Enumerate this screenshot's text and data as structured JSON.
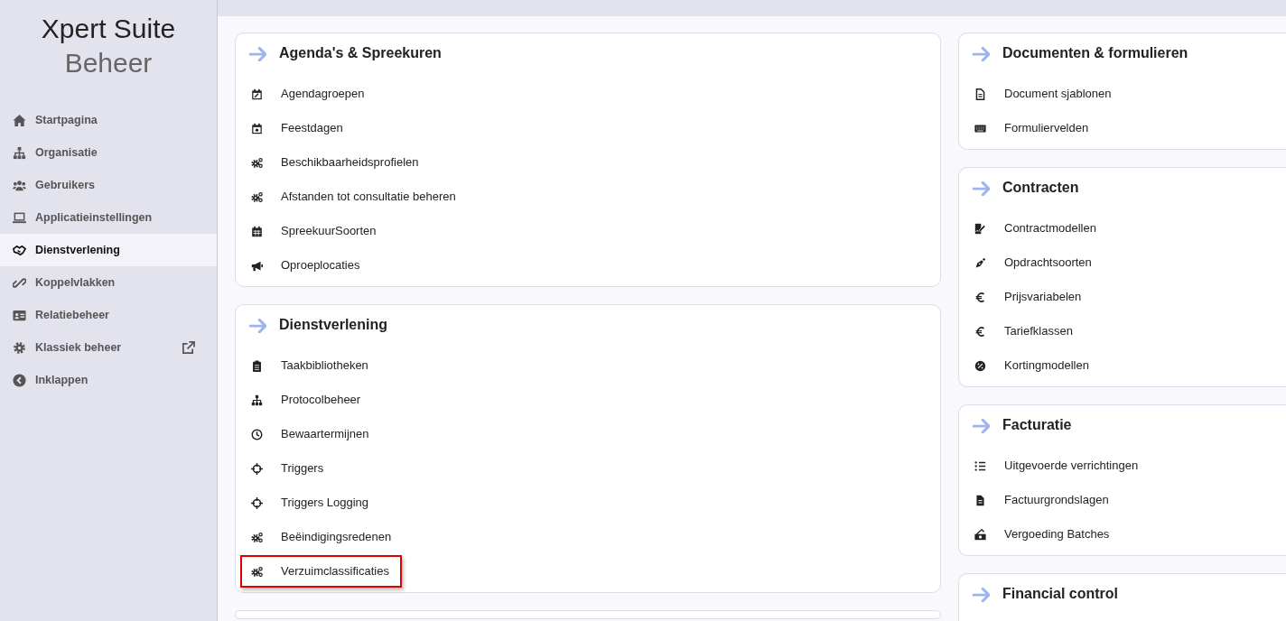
{
  "logo": {
    "line_1": "Xpert Suite",
    "line_2": "Beheer"
  },
  "sidebar": {
    "items": [
      {
        "label": "Startpagina",
        "kind": "home",
        "selected": false,
        "external": false
      },
      {
        "label": "Organisatie",
        "kind": "sitemap",
        "selected": false,
        "external": false
      },
      {
        "label": "Gebruikers",
        "kind": "users",
        "selected": false,
        "external": false
      },
      {
        "label": "Applicatieinstellingen",
        "kind": "laptop",
        "selected": false,
        "external": false
      },
      {
        "label": "Dienstverlening",
        "kind": "handshake",
        "selected": true,
        "external": false
      },
      {
        "label": "Koppelvlakken",
        "kind": "link",
        "selected": false,
        "external": false
      },
      {
        "label": "Relatiebeheer",
        "kind": "idcard",
        "selected": false,
        "external": false
      },
      {
        "label": "Klassiek beheer",
        "kind": "gear",
        "selected": false,
        "external": true
      },
      {
        "label": "Inklappen",
        "kind": "chevron",
        "selected": false,
        "external": false
      }
    ]
  },
  "columns": [
    {
      "cards": [
        {
          "title": "Agenda's & Spreekuren",
          "items": [
            {
              "label": "Agendagroepen",
              "kind": "calendar-edit",
              "highlighted": false
            },
            {
              "label": "Feestdagen",
              "kind": "calendar-star",
              "highlighted": false
            },
            {
              "label": "Beschikbaarheidsprofielen",
              "kind": "gears",
              "highlighted": false
            },
            {
              "label": "Afstanden tot consultatie beheren",
              "kind": "gears",
              "highlighted": false
            },
            {
              "label": "SpreekuurSoorten",
              "kind": "calendar",
              "highlighted": false
            },
            {
              "label": "Oproeplocaties",
              "kind": "megaphone",
              "highlighted": false
            }
          ]
        },
        {
          "title": "Dienstverlening",
          "items": [
            {
              "label": "Taakbibliotheken",
              "kind": "clipboard",
              "highlighted": false
            },
            {
              "label": "Protocolbeheer",
              "kind": "sitemap",
              "highlighted": false
            },
            {
              "label": "Bewaartermijnen",
              "kind": "clock",
              "highlighted": false
            },
            {
              "label": "Triggers",
              "kind": "crosshair",
              "highlighted": false
            },
            {
              "label": "Triggers Logging",
              "kind": "crosshair",
              "highlighted": false
            },
            {
              "label": "Beëindigingsredenen",
              "kind": "gears",
              "highlighted": false
            },
            {
              "label": "Verzuimclassificaties",
              "kind": "gears",
              "highlighted": true
            }
          ]
        }
      ]
    },
    {
      "cards": [
        {
          "title": "Documenten & formulieren",
          "items": [
            {
              "label": "Document sjablonen",
              "kind": "file",
              "highlighted": false
            },
            {
              "label": "Formuliervelden",
              "kind": "keyboard",
              "highlighted": false
            }
          ]
        },
        {
          "title": "Contracten",
          "items": [
            {
              "label": "Contractmodellen",
              "kind": "signature",
              "highlighted": false
            },
            {
              "label": "Opdrachtsoorten",
              "kind": "pen",
              "highlighted": false
            },
            {
              "label": "Prijsvariabelen",
              "kind": "euro",
              "highlighted": false
            },
            {
              "label": "Tariefklassen",
              "kind": "euro",
              "highlighted": false
            },
            {
              "label": "Kortingmodellen",
              "kind": "percent",
              "highlighted": false
            }
          ]
        },
        {
          "title": "Facturatie",
          "items": [
            {
              "label": "Uitgevoerde verrichtingen",
              "kind": "list",
              "highlighted": false
            },
            {
              "label": "Factuurgrondslagen",
              "kind": "invoice",
              "highlighted": false
            },
            {
              "label": "Vergoeding Batches",
              "kind": "money",
              "highlighted": false
            }
          ]
        },
        {
          "title": "Financial control"
        }
      ]
    }
  ]
}
